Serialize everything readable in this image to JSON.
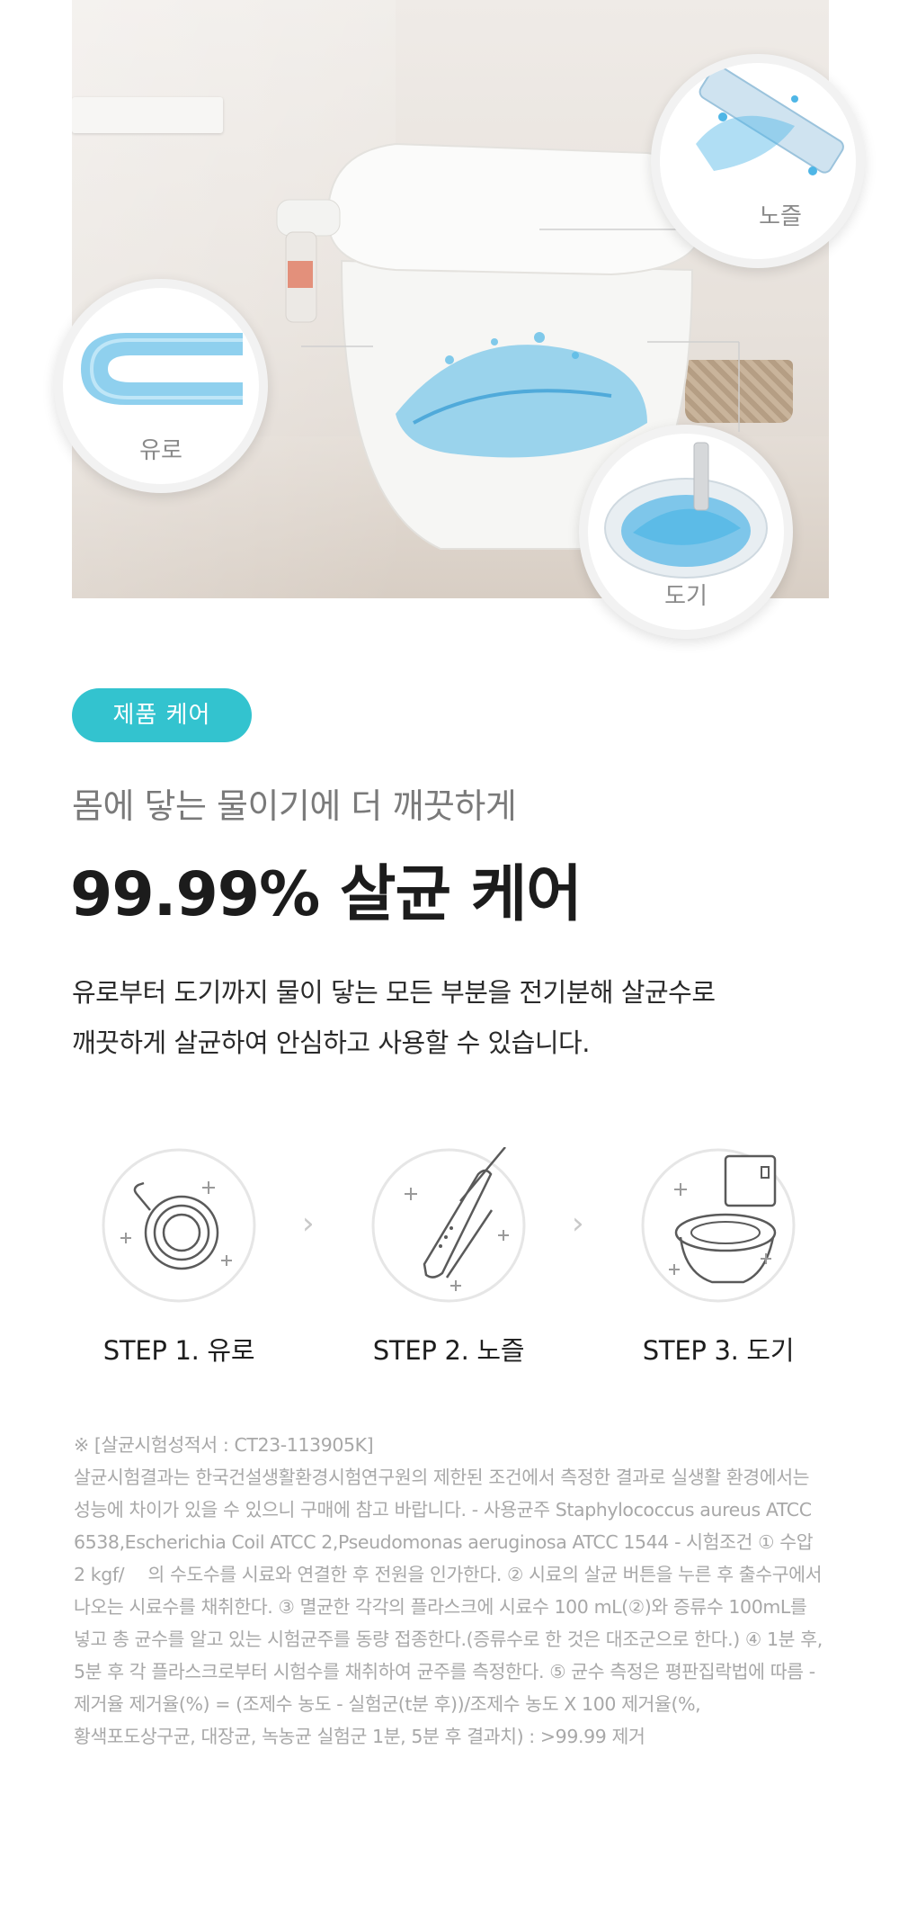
{
  "hero": {
    "callouts": {
      "pipe": "유로",
      "nozzle": "노즐",
      "bowl": "도기"
    },
    "colors": {
      "water": "#4fb6e6",
      "pipe": "#8fd0ee"
    }
  },
  "badge": {
    "label": "제품 케어",
    "color": "#33c3cf"
  },
  "subtitle": "몸에 닿는 물이기에 더 깨끗하게",
  "headline": "99.99% 살균 케어",
  "description": {
    "line1": "유로부터 도기까지 물이 닿는 모든 부분을 전기분해 살균수로",
    "line2": "깨끗하게 살균하여 안심하고 사용할 수 있습니다."
  },
  "steps": [
    {
      "label": "STEP 1. 유로",
      "icon": "pipe-coil-icon"
    },
    {
      "label": "STEP 2. 노즐",
      "icon": "nozzle-icon"
    },
    {
      "label": "STEP 3. 도기",
      "icon": "toilet-icon"
    }
  ],
  "step_arrow": "›",
  "footnote": {
    "lines": [
      "※ [살균시험성적서 : CT23-113905K]",
      "살균시험결과는 한국건설생활환경시험연구원의 제한된 조건에서 측정한 결과로 실생활 환경에서는",
      "성능에 차이가 있을 수 있으니 구매에 참고 바랍니다. - 사용균주 Staphylococcus aureus ATCC",
      "6538,Escherichia Coil ATCC 2,Pseudomonas aeruginosa ATCC 1544 - 시험조건 ① 수압",
      "2 kgf/　 의 수도수를 시료와 연결한 후 전원을 인가한다. ② 시료의 살균 버튼을 누른 후 출수구에서",
      "나오는 시료수를 채취한다. ③ 멸균한 각각의 플라스크에 시료수 100 mL(②)와 증류수 100mL를",
      "넣고 총 균수를 알고 있는 시험균주를 동량 접종한다.(증류수로 한 것은 대조군으로 한다.) ④ 1분 후,",
      "5분 후 각 플라스크로부터 시험수를 채취하여 균주를 측정한다. ⑤ 균수 측정은 평판집락법에 따름 -",
      "제거율 제거율(%) = (조제수 농도 - 실험군(t분 후))/조제수 농도 X 100 제거율(%,",
      "황색포도상구균, 대장균, 녹농균 실험군 1분, 5분 후 결과치) : >99.99 제거"
    ]
  }
}
